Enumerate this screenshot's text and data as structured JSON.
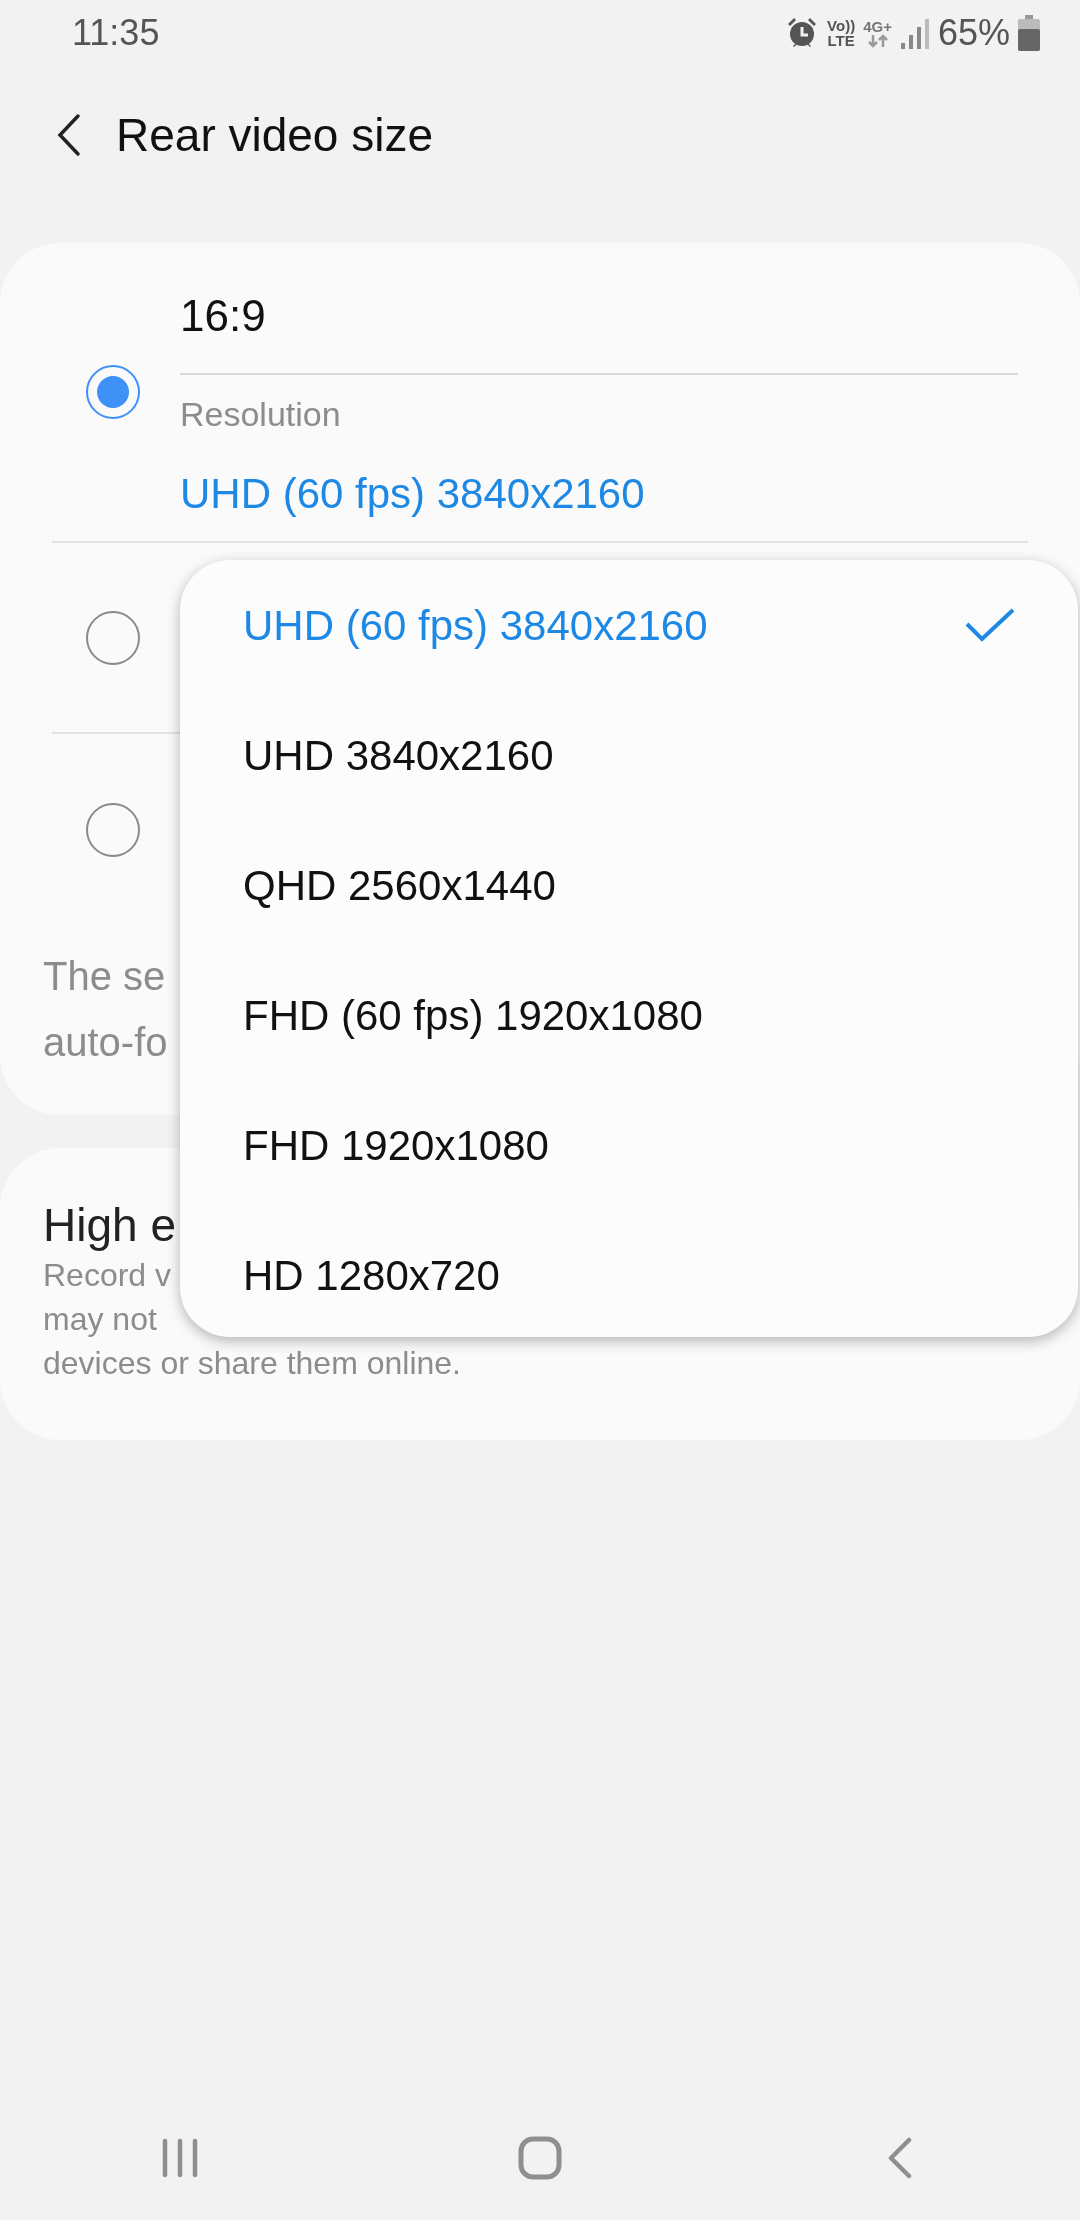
{
  "status_bar": {
    "time": "11:35",
    "volte_top": "Vo))",
    "volte_bottom": "LTE",
    "network": "4G+",
    "battery": "65%"
  },
  "header": {
    "title": "Rear video size"
  },
  "ratio_options": [
    {
      "label": "16:9",
      "sublabel": "Resolution",
      "value": "UHD (60 fps) 3840x2160",
      "selected": true
    },
    {
      "selected": false
    },
    {
      "selected": false
    }
  ],
  "ratio_note_lines": [
    "The se",
    "auto-fo"
  ],
  "hevc": {
    "title": "High e",
    "description_lines": [
      "Record v",
      "may not",
      "devices or share them online."
    ]
  },
  "resolution_menu": [
    {
      "label": "UHD (60 fps) 3840x2160",
      "selected": true
    },
    {
      "label": "UHD 3840x2160",
      "selected": false
    },
    {
      "label": "QHD 2560x1440",
      "selected": false
    },
    {
      "label": "FHD (60 fps) 1920x1080",
      "selected": false
    },
    {
      "label": "FHD 1920x1080",
      "selected": false
    },
    {
      "label": "HD 1280x720",
      "selected": false
    }
  ]
}
